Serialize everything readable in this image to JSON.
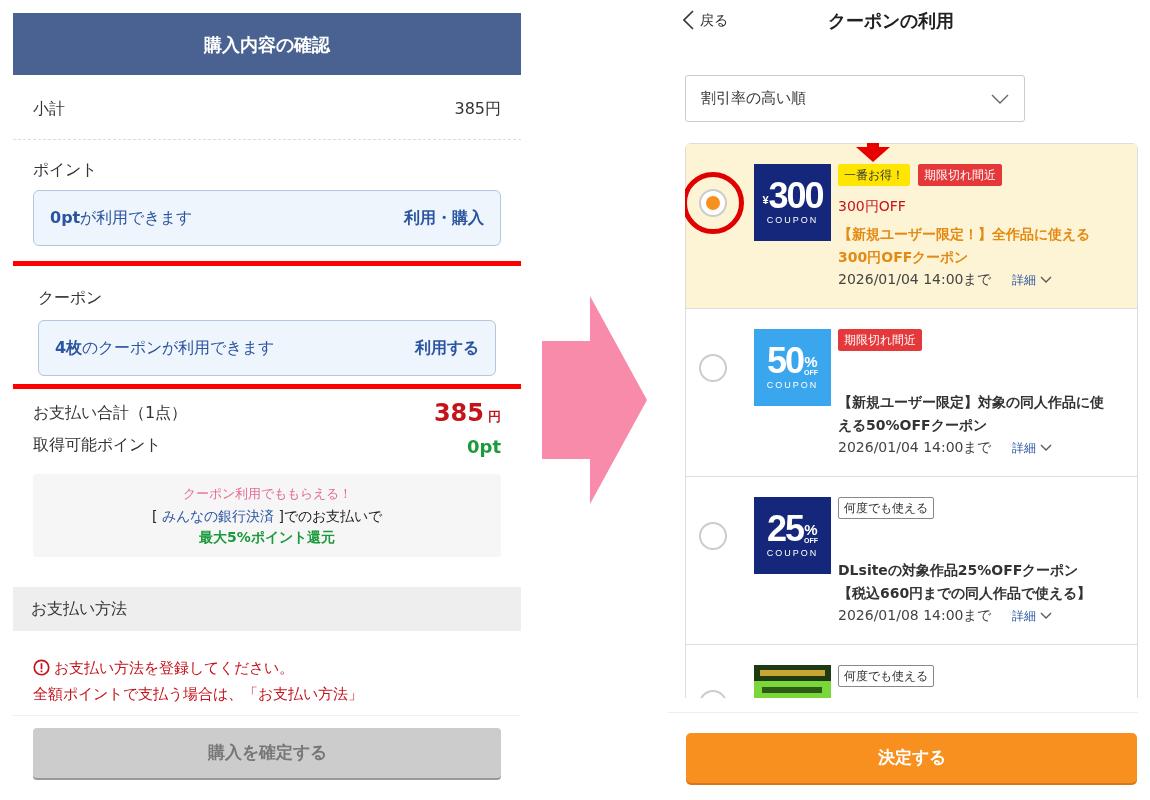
{
  "checkout": {
    "title": "購入内容の確認",
    "subtotal": {
      "label": "小計",
      "value": "385円"
    },
    "points": {
      "label": "ポイント",
      "text": "**0pt**が利用できます",
      "action": "利用・購入"
    },
    "coupon": {
      "label": "クーポン",
      "text": "**4枚**のクーポンが利用できます",
      "action": "利用する",
      "highlighted": true
    },
    "total": {
      "label": "お支払い合計（1点）",
      "amount": "385",
      "unit": "円"
    },
    "earn": {
      "label": "取得可能ポイント",
      "value": "0pt"
    },
    "promo": {
      "headline": "クーポン利用でももらえる！",
      "before": "[ ",
      "link": "みんなの銀行決済",
      "after": " ]でのお支払いで",
      "reward": "最大5%ポイント還元"
    },
    "payment": {
      "heading": "お支払い方法",
      "error": "お支払い方法を登録してください。",
      "note": "全額ポイントで支払う場合は、「お支払い方法」"
    },
    "confirm": {
      "label": "購入を確定する",
      "disabled": true
    }
  },
  "coupon_screen": {
    "back": "戻る",
    "title": "クーポンの利用",
    "sort": {
      "value": "割引率の高い順"
    },
    "coupons": [
      {
        "selected": true,
        "circled": true,
        "logo": {
          "kind": "yen",
          "color": "#15277a",
          "prefix": "¥",
          "figure": "300",
          "sub": "COUPON"
        },
        "tags": [
          {
            "kind": "best",
            "label": "一番お得！",
            "pointed": true
          },
          {
            "kind": "expiring",
            "label": "期限切れ間近",
            "pointed": false
          }
        ],
        "amount": "300円OFF",
        "title": "【新規ユーザー限定！】全作品に使える300円OFFクーポン",
        "expiry": "2026/01/04 14:00まで",
        "details": "詳細"
      },
      {
        "selected": false,
        "circled": false,
        "logo": {
          "kind": "percent",
          "color": "#3aa6ee",
          "figure": "50",
          "unit": "%",
          "off": "OFF",
          "sub": "COUPON"
        },
        "tags": [
          {
            "kind": "expiring",
            "label": "期限切れ間近",
            "pointed": false
          }
        ],
        "title": "【新規ユーザー限定】対象の同人作品に使える50%OFFクーポン",
        "expiry": "2026/01/04 14:00まで",
        "details": "詳細"
      },
      {
        "selected": false,
        "circled": false,
        "logo": {
          "kind": "percent",
          "color": "#15277a",
          "figure": "25",
          "unit": "%",
          "off": "OFF",
          "sub": "COUPON"
        },
        "tags": [
          {
            "kind": "reusable",
            "label": "何度でも使える",
            "pointed": false
          }
        ],
        "title": "DLsiteの対象作品25%OFFクーポン【税込660円までの同人作品で使える】",
        "expiry": "2026/01/08 14:00まで",
        "details": "詳細"
      },
      {
        "selected": false,
        "circled": false,
        "logo": {
          "kind": "picture"
        },
        "tags": [
          {
            "kind": "reusable",
            "label": "何度でも使える",
            "pointed": false
          }
        ]
      }
    ],
    "submit": "決定する"
  }
}
